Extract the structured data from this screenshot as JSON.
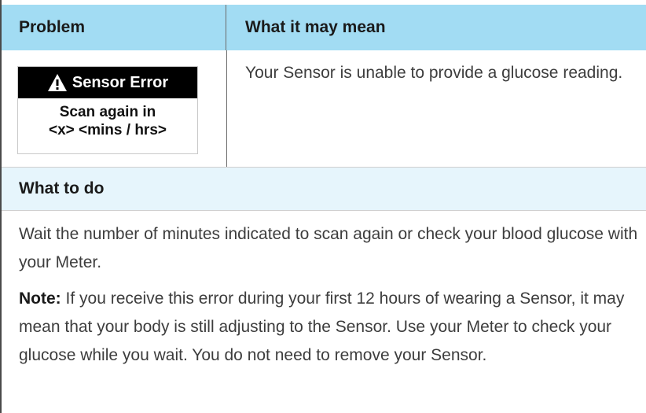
{
  "header": {
    "problem": "Problem",
    "meaning": "What it may mean"
  },
  "screen": {
    "title": "Sensor Error",
    "icon": "warning-triangle-icon",
    "line1": "Scan again in",
    "line2": "<x> <mins / hrs>"
  },
  "meaning_text": "Your Sensor is unable to provide a glucose reading.",
  "todo": {
    "header": "What to do",
    "para1": "Wait the number of minutes indicated to scan again or check your blood glucose with your Meter.",
    "note_label": "Note:",
    "note_text": " If you receive this error during your first 12 hours of wearing a Sensor, it may mean that your body is still adjusting to the Sensor. Use your Meter to check your glucose while you wait. You do not need to remove your Sensor."
  },
  "colors": {
    "header_bg": "#a2dcf3",
    "todo_bg": "#e6f5fc"
  }
}
